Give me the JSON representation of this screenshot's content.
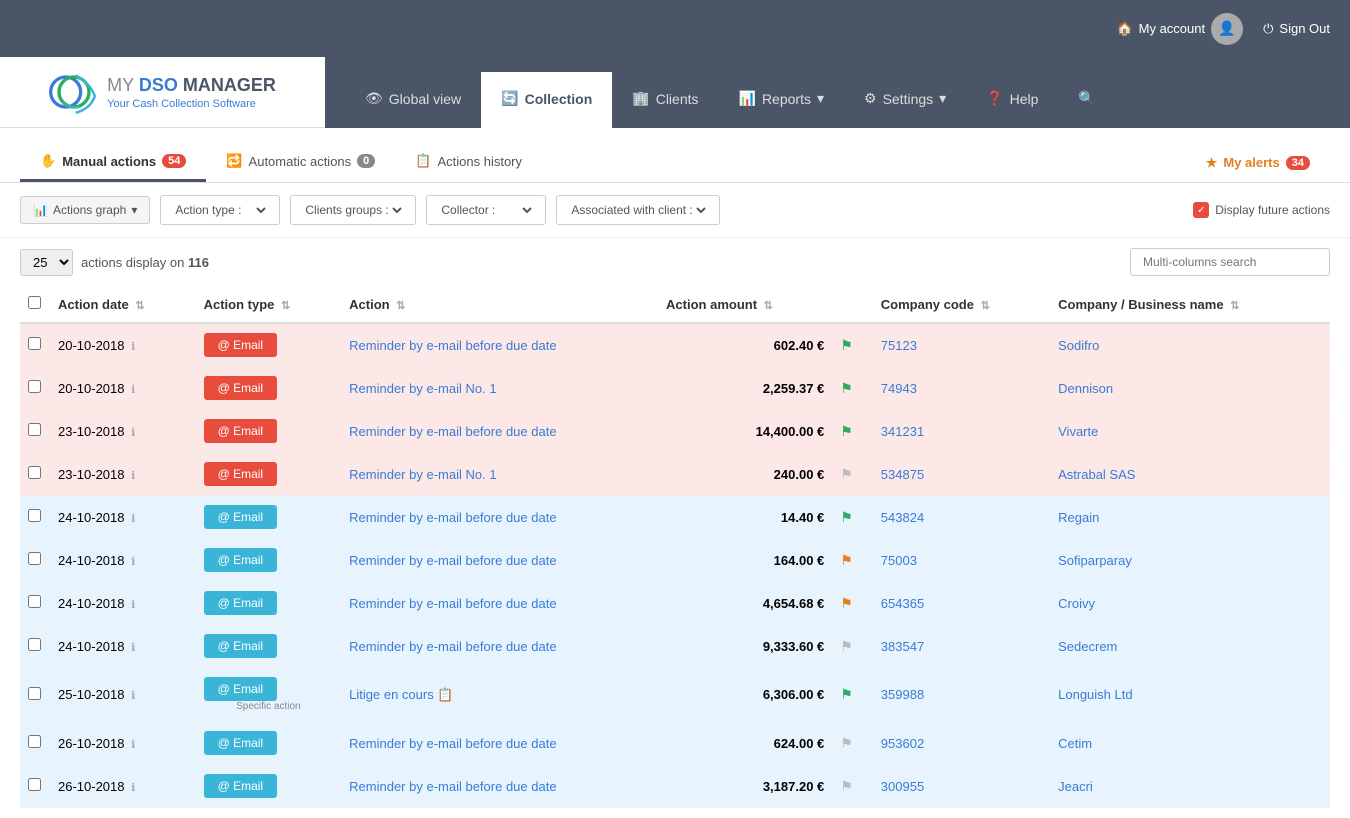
{
  "topBar": {
    "myAccount": "My account",
    "signOut": "Sign Out"
  },
  "logo": {
    "title": "MY DSO MANAGER",
    "subtitle": "Your Cash Collection Software"
  },
  "nav": {
    "items": [
      {
        "label": "Global view",
        "icon": "👁",
        "active": false
      },
      {
        "label": "Collection",
        "icon": "🔄",
        "active": true
      },
      {
        "label": "Clients",
        "icon": "🏢",
        "active": false
      },
      {
        "label": "Reports",
        "icon": "📊",
        "active": false,
        "hasDropdown": true
      },
      {
        "label": "Settings",
        "icon": "⚙",
        "active": false,
        "hasDropdown": true
      },
      {
        "label": "Help",
        "icon": "❓",
        "active": false
      },
      {
        "label": "🔍",
        "icon": "",
        "active": false
      }
    ]
  },
  "tabs": {
    "items": [
      {
        "label": "Manual actions",
        "icon": "✋",
        "badge": "54",
        "badgeColor": "red",
        "active": true
      },
      {
        "label": "Automatic actions",
        "icon": "🔁",
        "badge": "0",
        "badgeColor": "grey",
        "active": false
      },
      {
        "label": "Actions history",
        "icon": "📋",
        "badge": null,
        "active": false
      }
    ],
    "myAlerts": "My alerts",
    "myAlertsBadge": "34"
  },
  "filters": {
    "actionsGraph": "Actions graph",
    "actionsGraphIcon": "📊",
    "actionType": "Action type :",
    "clientsGroups": "Clients groups :",
    "collector": "Collector :",
    "associatedClient": "Associated with client :",
    "displayFutureActions": "Display future actions"
  },
  "tableControls": {
    "displayCount": "25",
    "displayText": "actions display on",
    "total": "116",
    "searchPlaceholder": "Multi-columns search"
  },
  "table": {
    "headers": [
      {
        "label": "Action date",
        "sortable": true
      },
      {
        "label": "Action type",
        "sortable": true
      },
      {
        "label": "Action",
        "sortable": true
      },
      {
        "label": "Action amount",
        "sortable": true
      },
      {
        "label": "",
        "sortable": false
      },
      {
        "label": "Company code",
        "sortable": true
      },
      {
        "label": "Company / Business name",
        "sortable": true
      }
    ],
    "rows": [
      {
        "date": "20-10-2018",
        "btnType": "red",
        "btnLabel": "@ Email",
        "action": "Reminder by e-mail before due date",
        "amount": "602.40 €",
        "flag": "green",
        "companyCode": "75123",
        "companyName": "Sodifro",
        "rowColor": "red",
        "specificAction": null
      },
      {
        "date": "20-10-2018",
        "btnType": "red",
        "btnLabel": "@ Email",
        "action": "Reminder by e-mail No. 1",
        "amount": "2,259.37 €",
        "flag": "green",
        "companyCode": "74943",
        "companyName": "Dennison",
        "rowColor": "red",
        "specificAction": null
      },
      {
        "date": "23-10-2018",
        "btnType": "red",
        "btnLabel": "@ Email",
        "action": "Reminder by e-mail before due date",
        "amount": "14,400.00 €",
        "flag": "green",
        "companyCode": "341231",
        "companyName": "Vivarte",
        "rowColor": "red",
        "specificAction": null
      },
      {
        "date": "23-10-2018",
        "btnType": "red",
        "btnLabel": "@ Email",
        "action": "Reminder by e-mail No. 1",
        "amount": "240.00 €",
        "flag": "grey",
        "companyCode": "534875",
        "companyName": "Astrabal SAS",
        "rowColor": "red",
        "specificAction": null
      },
      {
        "date": "24-10-2018",
        "btnType": "blue",
        "btnLabel": "@ Email",
        "action": "Reminder by e-mail before due date",
        "amount": "14.40 €",
        "flag": "green",
        "companyCode": "543824",
        "companyName": "Regain",
        "rowColor": "blue",
        "specificAction": null
      },
      {
        "date": "24-10-2018",
        "btnType": "blue",
        "btnLabel": "@ Email",
        "action": "Reminder by e-mail before due date",
        "amount": "164.00 €",
        "flag": "orange",
        "companyCode": "75003",
        "companyName": "Sofiparparay",
        "rowColor": "blue",
        "specificAction": null
      },
      {
        "date": "24-10-2018",
        "btnType": "blue",
        "btnLabel": "@ Email",
        "action": "Reminder by e-mail before due date",
        "amount": "4,654.68 €",
        "flag": "orange",
        "companyCode": "654365",
        "companyName": "Croivy",
        "rowColor": "blue",
        "specificAction": null
      },
      {
        "date": "24-10-2018",
        "btnType": "blue",
        "btnLabel": "@ Email",
        "action": "Reminder by e-mail before due date",
        "amount": "9,333.60 €",
        "flag": "grey",
        "companyCode": "383547",
        "companyName": "Sedecrem",
        "rowColor": "blue",
        "specificAction": null
      },
      {
        "date": "25-10-2018",
        "btnType": "blue",
        "btnLabel": "@ Email",
        "action": "Litige en cours 📋",
        "amount": "6,306.00 €",
        "flag": "green",
        "companyCode": "359988",
        "companyName": "Longuish Ltd",
        "rowColor": "blue",
        "specificAction": "Specific action"
      },
      {
        "date": "26-10-2018",
        "btnType": "blue",
        "btnLabel": "@ Email",
        "action": "Reminder by e-mail before due date",
        "amount": "624.00 €",
        "flag": "grey",
        "companyCode": "953602",
        "companyName": "Cetim",
        "rowColor": "blue",
        "specificAction": null
      },
      {
        "date": "26-10-2018",
        "btnType": "blue",
        "btnLabel": "@ Email",
        "action": "Reminder by e-mail before due date",
        "amount": "3,187.20 €",
        "flag": "grey",
        "companyCode": "300955",
        "companyName": "Jeacri",
        "rowColor": "blue",
        "specificAction": null
      }
    ]
  }
}
